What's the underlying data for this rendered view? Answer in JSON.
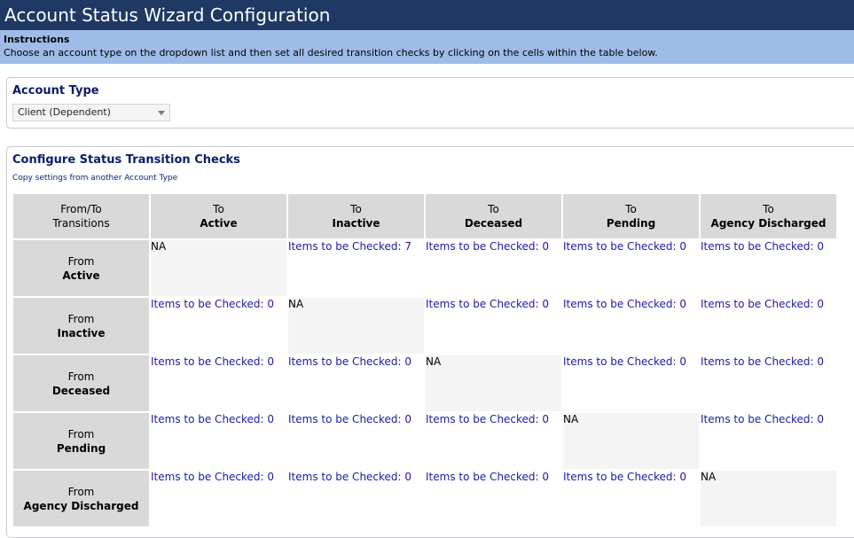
{
  "window": {
    "title": "Account Status Wizard Configuration"
  },
  "instructions": {
    "title": "Instructions",
    "text": "Choose an account type on the dropdown list and then set all desired transition checks by clicking on the cells within the table below."
  },
  "account_type": {
    "label": "Account Type",
    "selected": "Client (Dependent)"
  },
  "transitions": {
    "label": "Configure Status Transition Checks",
    "copy_link": "Copy settings from another Account Type",
    "corner_line1": "From/To",
    "corner_line2": "Transitions",
    "to_prefix": "To",
    "from_prefix": "From",
    "columns": [
      "Active",
      "Inactive",
      "Deceased",
      "Pending",
      "Agency Discharged"
    ],
    "rows": [
      {
        "from": "Active",
        "cells": [
          "NA",
          "Items to be Checked: 7",
          "Items to be Checked: 0",
          "Items to be Checked: 0",
          "Items to be Checked: 0"
        ]
      },
      {
        "from": "Inactive",
        "cells": [
          "Items to be Checked: 0",
          "NA",
          "Items to be Checked: 0",
          "Items to be Checked: 0",
          "Items to be Checked: 0"
        ]
      },
      {
        "from": "Deceased",
        "cells": [
          "Items to be Checked: 0",
          "Items to be Checked: 0",
          "NA",
          "Items to be Checked: 0",
          "Items to be Checked: 0"
        ]
      },
      {
        "from": "Pending",
        "cells": [
          "Items to be Checked: 0",
          "Items to be Checked: 0",
          "Items to be Checked: 0",
          "NA",
          "Items to be Checked: 0"
        ]
      },
      {
        "from": "Agency Discharged",
        "cells": [
          "Items to be Checked: 0",
          "Items to be Checked: 0",
          "Items to be Checked: 0",
          "Items to be Checked: 0",
          "NA"
        ]
      }
    ]
  },
  "colors": {
    "titlebar": "#1f3864",
    "instructions_bg": "#9fbce8",
    "header_bg": "#d9d9d9",
    "link": "#1a1aa8",
    "section_title": "#0b1c6b",
    "na_bg": "#f4f4f4"
  }
}
